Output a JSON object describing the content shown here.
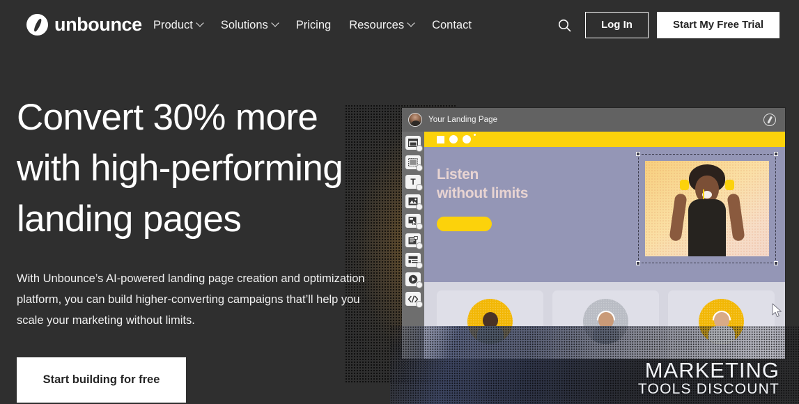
{
  "brand": {
    "name": "unbounce",
    "logo_icon": "unbounce-logo-icon",
    "accent_yellow": "#fcd20b",
    "background": "#2f2f2f",
    "periwinkle": "#9496b6",
    "card_bg": "#dfdfe8"
  },
  "header": {
    "nav": [
      {
        "label": "Product",
        "has_dropdown": true
      },
      {
        "label": "Solutions",
        "has_dropdown": true
      },
      {
        "label": "Pricing",
        "has_dropdown": false
      },
      {
        "label": "Resources",
        "has_dropdown": true
      },
      {
        "label": "Contact",
        "has_dropdown": false
      }
    ],
    "search_icon": "search-icon",
    "login_label": "Log In",
    "trial_label": "Start My Free Trial"
  },
  "hero": {
    "headline_line1": "Convert 30% more",
    "headline_line2": "with high-performing",
    "headline_line3": "landing pages",
    "subcopy": "With Unbounce’s AI-powered landing page creation and optimization platform, you can build higher-converting campaigns that’ll help you scale your marketing without limits.",
    "cta_label": "Start building for free"
  },
  "builder": {
    "window_title": "Your Landing Page",
    "avatar_icon": "user-avatar",
    "brand_icon": "unbounce-logo-icon",
    "toolbar": [
      {
        "icon": "section-icon",
        "name": "tool-section"
      },
      {
        "icon": "box-icon",
        "name": "tool-box"
      },
      {
        "icon": "text-icon",
        "name": "tool-text"
      },
      {
        "icon": "image-icon",
        "name": "tool-image"
      },
      {
        "icon": "button-icon",
        "name": "tool-button"
      },
      {
        "icon": "form-icon",
        "name": "tool-form"
      },
      {
        "icon": "list-icon",
        "name": "tool-list"
      },
      {
        "icon": "video-icon",
        "name": "tool-video"
      },
      {
        "icon": "code-icon",
        "name": "tool-code"
      }
    ],
    "canvas": {
      "hero_title_line1": "Listen",
      "hero_title_line2": "without limits",
      "hero_button_label": "",
      "selected_element": "hero-image",
      "cards": [
        {
          "avatar_bg": "#f2b705",
          "person": "dancing-woman"
        },
        {
          "avatar_bg": "#b9bcc4",
          "person": "woman-headphones"
        },
        {
          "avatar_bg": "#f2b705",
          "person": "man-headphones"
        }
      ]
    }
  },
  "watermark": {
    "line1": "MARKETING",
    "line2": "TOOLS DISCOUNT"
  }
}
